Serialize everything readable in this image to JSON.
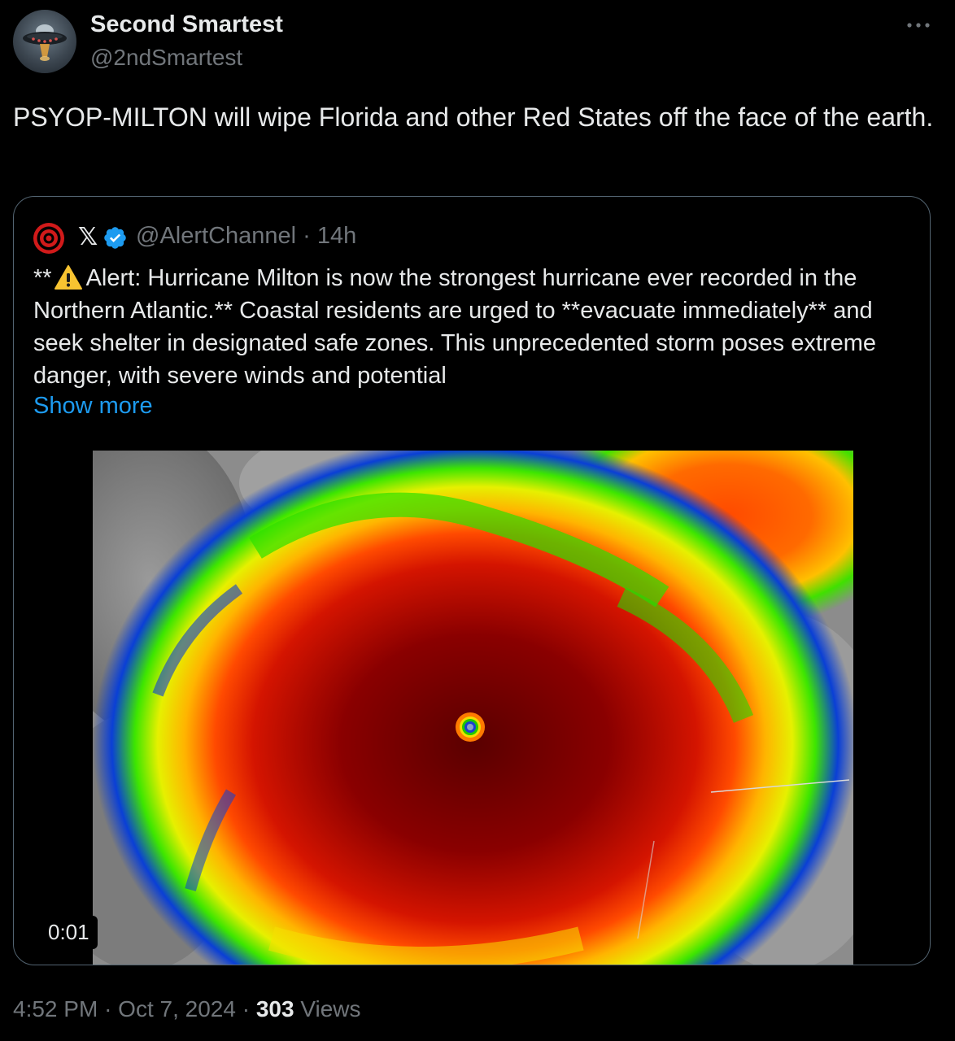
{
  "author": {
    "display_name": "Second Smartest",
    "handle": "@2ndSmartest",
    "avatar_icon": "ufo-icon"
  },
  "more_icon": "more-dots-icon",
  "tweet_text": "PSYOP-MILTON will wipe Florida and other Red States off the face of the earth.",
  "quoted": {
    "avatar_icon": "target-icon",
    "x_logo": "𝕏",
    "verified_icon": "verified-badge-icon",
    "handle": "@AlertChannel",
    "separator": "·",
    "time_ago": "14h",
    "text_prefix": "**",
    "warning_icon": "warning-icon",
    "text": "Alert: Hurricane Milton is now the strongest hurricane ever recorded in the Northern Atlantic.** Coastal residents are urged to **evacuate immediately** and seek shelter in designated safe zones. This unprecedented storm poses extreme danger, with severe winds and potential",
    "show_more": "Show more",
    "video_timer": "0:01"
  },
  "footer": {
    "time": "4:52 PM",
    "sep1": "·",
    "date": "Oct 7, 2024",
    "sep2": "·",
    "views_count": "303",
    "views_label": "Views"
  },
  "colors": {
    "background": "#000000",
    "text_primary": "#e7e9ea",
    "text_secondary": "#71767b",
    "link": "#1d9bf0",
    "border": "#536471",
    "verified": "#1d9bf0"
  }
}
